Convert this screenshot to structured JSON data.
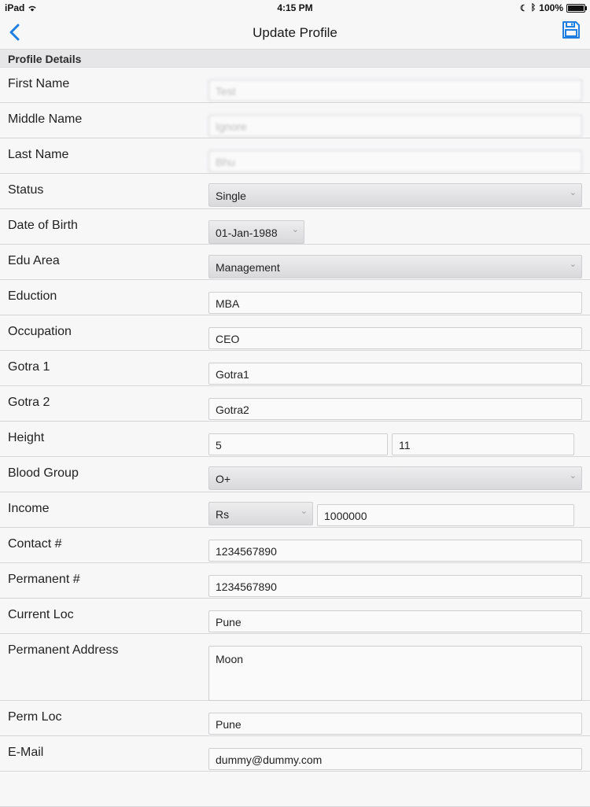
{
  "status_bar": {
    "device": "iPad",
    "time": "4:15 PM",
    "battery": "100%"
  },
  "nav": {
    "title": "Update Profile"
  },
  "section": {
    "title": "Profile Details"
  },
  "fields": {
    "first_name": {
      "label": "First Name",
      "value": "Test"
    },
    "middle_name": {
      "label": "Middle Name",
      "value": "Ignore"
    },
    "last_name": {
      "label": "Last Name",
      "value": "Bhu"
    },
    "status": {
      "label": "Status",
      "value": "Single"
    },
    "dob": {
      "label": "Date of Birth",
      "value": "01-Jan-1988"
    },
    "edu_area": {
      "label": "Edu Area",
      "value": "Management"
    },
    "education": {
      "label": "Eduction",
      "value": "MBA"
    },
    "occupation": {
      "label": "Occupation",
      "value": "CEO"
    },
    "gotra1": {
      "label": "Gotra 1",
      "value": "Gotra1"
    },
    "gotra2": {
      "label": "Gotra 2",
      "value": "Gotra2"
    },
    "height": {
      "label": "Height",
      "feet": "5",
      "inches": "11"
    },
    "blood_group": {
      "label": "Blood Group",
      "value": "O+"
    },
    "income": {
      "label": "Income",
      "currency": "Rs",
      "value": "1000000"
    },
    "contact": {
      "label": "Contact #",
      "value": "1234567890"
    },
    "permanent": {
      "label": "Permanent #",
      "value": "1234567890"
    },
    "current_loc": {
      "label": "Current Loc",
      "value": "Pune"
    },
    "permanent_address": {
      "label": "Permanent Address",
      "value": "Moon"
    },
    "perm_loc": {
      "label": "Perm Loc",
      "value": "Pune"
    },
    "email": {
      "label": "E-Mail",
      "value": "dummy@dummy.com"
    }
  },
  "icons": {
    "back": "chevron-left-icon",
    "save": "floppy-disk-icon"
  },
  "colors": {
    "accent": "#1e7fe0",
    "background": "#f7f7f8",
    "section": "#e6e6e8"
  }
}
